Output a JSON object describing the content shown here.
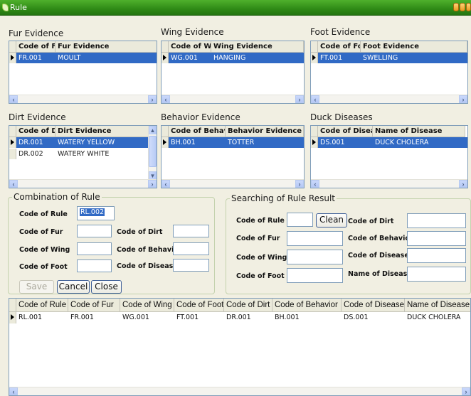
{
  "window": {
    "title": "Rule"
  },
  "fur": {
    "title": "Fur Evidence",
    "columns": [
      "Code of Fur",
      "Fur Evidence"
    ],
    "rows": [
      [
        "FR.001",
        "MOULT"
      ]
    ]
  },
  "wing": {
    "title": "Wing Evidence",
    "columns": [
      "Code of Wing",
      "Wing Evidence"
    ],
    "rows": [
      [
        "WG.001",
        "HANGING"
      ]
    ]
  },
  "foot": {
    "title": "Foot Evidence",
    "columns": [
      "Code of Foot",
      "Foot Evidence"
    ],
    "rows": [
      [
        "FT.001",
        "SWELLING"
      ]
    ]
  },
  "dirt": {
    "title": "Dirt Evidence",
    "columns": [
      "Code of Dirt",
      "Dirt Evidence"
    ],
    "rows": [
      [
        "DR.001",
        "WATERY YELLOW"
      ],
      [
        "DR.002",
        "WATERY WHITE"
      ]
    ]
  },
  "behavior": {
    "title": "Behavior Evidence",
    "columns": [
      "Code of Behavior",
      "Behavior Evidence"
    ],
    "rows": [
      [
        "BH.001",
        "TOTTER"
      ]
    ]
  },
  "disease": {
    "title": "Duck Diseases",
    "columns": [
      "Code of Disease",
      "Name of Disease"
    ],
    "rows": [
      [
        "DS.001",
        "DUCK CHOLERA"
      ]
    ]
  },
  "combination": {
    "title": "Combination of Rule",
    "code_of_rule_label": "Code of Rule",
    "code_of_rule_value": "RL.002",
    "code_of_fur_label": "Code of Fur",
    "code_of_wing_label": "Code of Wing",
    "code_of_foot_label": "Code of Foot",
    "code_of_dirt_label": "Code of Dirt",
    "code_of_behavior_label": "Code of Behavior",
    "code_of_disease_label": "Code of Disease",
    "save_label": "Save",
    "cancel_label": "Cancel",
    "close_label": "Close"
  },
  "search": {
    "title": "Searching of Rule Result",
    "code_of_rule_label": "Code of Rule",
    "clean_label": "Clean",
    "code_of_fur_label": "Code of Fur",
    "code_of_wing_label": "Code of Wing",
    "code_of_foot_label": "Code of Foot",
    "code_of_dirt_label": "Code of Dirt",
    "code_of_behavior_label": "Code of Behavior",
    "code_of_disease_label": "Code of Disease",
    "name_of_disease_label": "Name of Disease"
  },
  "rules": {
    "columns": [
      "Code of Rule",
      "Code of Fur",
      "Code of Wing",
      "Code of Foot",
      "Code of Dirt",
      "Code of Behavior",
      "Code of Disease",
      "Name of Disease"
    ],
    "rows": [
      [
        "RL.001",
        "FR.001",
        "WG.001",
        "FT.001",
        "DR.001",
        "BH.001",
        "DS.001",
        "DUCK CHOLERA"
      ]
    ]
  },
  "colors": {
    "titlebar": "#2f8a16",
    "window_bg": "#f1efe2",
    "selection": "#316ac5",
    "grid_border": "#7f9db9"
  }
}
